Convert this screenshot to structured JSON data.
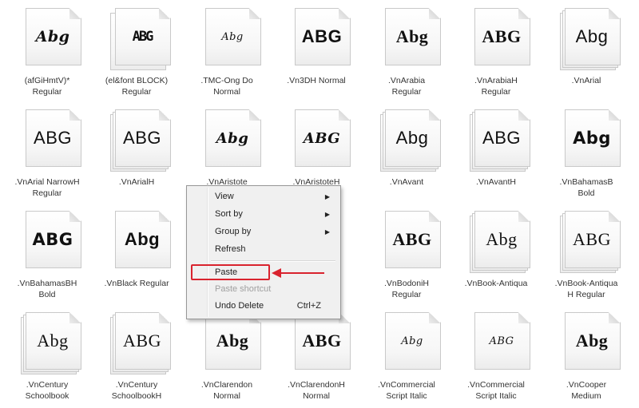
{
  "fonts": [
    {
      "sample": "Abg",
      "style": "deco",
      "pages": 1,
      "name": "(afGiHmtV)*",
      "sub": "Regular"
    },
    {
      "sample": "ABG",
      "style": "block",
      "pages": 2,
      "name": "(el&font BLOCK)",
      "sub": "Regular"
    },
    {
      "sample": "Abg",
      "style": "script",
      "pages": 1,
      "name": ".TMC-Ong Do",
      "sub": "Normal"
    },
    {
      "sample": "ABG",
      "style": "sansb",
      "pages": 1,
      "name": ".Vn3DH Normal",
      "sub": ""
    },
    {
      "sample": "Abg",
      "style": "serifb",
      "pages": 1,
      "name": ".VnArabia",
      "sub": "Regular"
    },
    {
      "sample": "ABG",
      "style": "serifb",
      "pages": 1,
      "name": ".VnArabiaH",
      "sub": "Regular"
    },
    {
      "sample": "Abg",
      "style": "sans",
      "pages": 3,
      "name": ".VnArial",
      "sub": ""
    },
    {
      "sample": "ABG",
      "style": "sans",
      "pages": 1,
      "name": ".VnArial NarrowH",
      "sub": "Regular"
    },
    {
      "sample": "ABG",
      "style": "sans",
      "pages": 3,
      "name": ".VnArialH",
      "sub": ""
    },
    {
      "sample": "Abg",
      "style": "italic",
      "pages": 1,
      "name": ".VnAristote",
      "sub": ""
    },
    {
      "sample": "ABG",
      "style": "italic",
      "pages": 1,
      "name": ".VnAristoteH",
      "sub": ""
    },
    {
      "sample": "Abg",
      "style": "sans",
      "pages": 3,
      "name": ".VnAvant",
      "sub": ""
    },
    {
      "sample": "ABG",
      "style": "sans",
      "pages": 3,
      "name": ".VnAvantH",
      "sub": ""
    },
    {
      "sample": "Abg",
      "style": "black",
      "pages": 1,
      "name": ".VnBahamasB",
      "sub": "Bold"
    },
    {
      "sample": "ABG",
      "style": "black",
      "pages": 1,
      "name": ".VnBahamasBH",
      "sub": "Bold"
    },
    {
      "sample": "Abg",
      "style": "sansb",
      "pages": 1,
      "name": ".VnBlack Regular",
      "sub": ""
    },
    null,
    null,
    {
      "sample": "ABG",
      "style": "serifb",
      "pages": 1,
      "name": ".VnBodoniH",
      "sub": "Regular"
    },
    {
      "sample": "Abg",
      "style": "serif",
      "pages": 3,
      "name": ".VnBook-Antiqua",
      "sub": ""
    },
    {
      "sample": "ABG",
      "style": "serif",
      "pages": 3,
      "name": ".VnBook-Antiqua",
      "sub": "H Regular"
    },
    {
      "sample": "Abg",
      "style": "serif",
      "pages": 3,
      "name": ".VnCentury",
      "sub": "Schoolbook"
    },
    {
      "sample": "ABG",
      "style": "serif",
      "pages": 3,
      "name": ".VnCentury",
      "sub": "SchoolbookH"
    },
    {
      "sample": "Abg",
      "style": "serifb",
      "pages": 1,
      "name": ".VnClarendon",
      "sub": "Normal"
    },
    {
      "sample": "ABG",
      "style": "serifb",
      "pages": 1,
      "name": ".VnClarendonH",
      "sub": "Normal"
    },
    {
      "sample": "Abg",
      "style": "script",
      "pages": 1,
      "name": ".VnCommercial",
      "sub": "Script Italic"
    },
    {
      "sample": "ABG",
      "style": "script",
      "pages": 1,
      "name": ".VnCommercial",
      "sub": "Script Italic"
    },
    {
      "sample": "Abg",
      "style": "serifb",
      "pages": 1,
      "name": ".VnCooper",
      "sub": "Medium"
    }
  ],
  "context_menu": {
    "view": "View",
    "sort_by": "Sort by",
    "group_by": "Group by",
    "refresh": "Refresh",
    "paste": "Paste",
    "paste_shortcut": "Paste shortcut",
    "undo_delete": "Undo Delete",
    "undo_shortcut": "Ctrl+Z"
  },
  "highlight_color": "#d9232e"
}
